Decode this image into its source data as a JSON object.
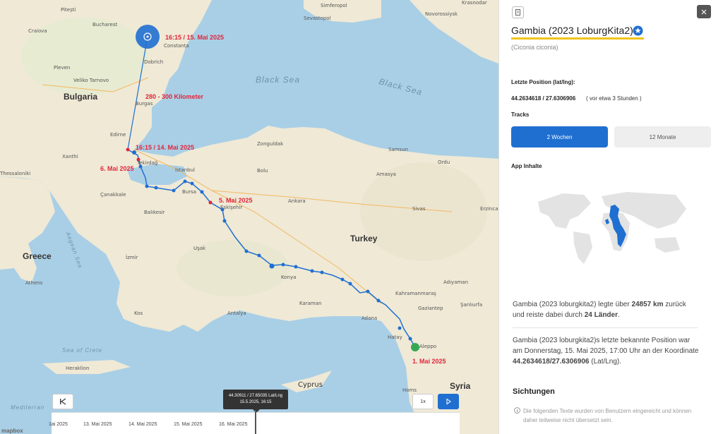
{
  "map": {
    "countries": {
      "bulgaria": "Bulgaria",
      "turkey": "Turkey",
      "greece": "Greece",
      "syria": "Syria"
    },
    "seas": {
      "black_sea_1": "Black Sea",
      "black_sea_2": "Black Sea",
      "aegean": "Aegean Sea",
      "crete": "Sea of Crete",
      "mediterranean": "Mediterran"
    },
    "cities": {
      "pitesti": "Pitești",
      "bucharest": "Bucharest",
      "craiova": "Craiova",
      "constanta": "Constanța",
      "pleven": "Pleven",
      "veliko": "Veliko Tarnovo",
      "burgas": "Burgas",
      "edirne": "Edirne",
      "xanthi": "Xanthi",
      "thessaloniki": "Thessaloniki",
      "tekirdag": "Tekirdağ",
      "istanbul": "İstanbul",
      "canakkale": "Çanakkale",
      "bursa": "Bursa",
      "eskisehir": "Eskişehir",
      "balikesir": "Balıkesir",
      "usak": "Uşak",
      "izmir": "İzmir",
      "athens": "Athens",
      "antalya": "Antalya",
      "konya": "Konya",
      "karaman": "Karaman",
      "ankara": "Ankara",
      "adana": "Adana",
      "hatay": "Hatay",
      "aleppo": "Aleppo",
      "kos": "Kos",
      "heraklion": "Heraklion",
      "cyprus": "Cyprus",
      "homs": "Homs",
      "sevastopol": "Sevastopol",
      "simferopol": "Simferopol",
      "novorossiysk": "Novorossiysk",
      "krasnodar": "Krasnodar",
      "zonguldak": "Zonguldak",
      "samsun": "Samsun",
      "ordu": "Ordu",
      "bolu": "Bolu",
      "amasya": "Amasya",
      "sivas": "Sivas",
      "erzincan": "Erzincan",
      "adiyaman": "Adıyaman",
      "gaziantep": "Gaziantep",
      "sanliurfa": "Şanlıurfa",
      "kahramanmaras": "Kahramanmaraş",
      "dobrich": "Dobrich"
    },
    "annotations": {
      "latest": "16:15 / 15. Mai 2025",
      "distance": "280 - 300 Kilometer",
      "may14": "16:15 / 14. Mai 2025",
      "may6": "6. Mai 2025",
      "may5": "5. Mai 2025",
      "may1": "1. Mai 2025"
    },
    "colors": {
      "track": "#1f6fd1",
      "annotation": "#e0263b",
      "water": "#a9cfe6",
      "land": "#efe9d6"
    }
  },
  "timeline": {
    "labels": [
      "1ai 2025",
      "13. Mai 2025",
      "14. Mai 2025",
      "15. Mai 2025",
      "16. Mai 2025"
    ],
    "tooltip_line1": "44.30911 / 27.65035 Lat/Lng",
    "tooltip_line2": "15.5.2025, 16:15",
    "prev_icon": "skip-back-icon",
    "speed_label": "1x",
    "play_icon": "play-icon",
    "mapbox": "mapbox"
  },
  "panel": {
    "close_icon": "close-icon",
    "doc_icon": "document-icon",
    "title": "Gambia (2023 LoburgKita2)",
    "species": "(Ciconia ciconia)",
    "last_position_label": "Letzte Position (lat/lng):",
    "last_position_value": "44.2634618 / 27.6306906",
    "last_position_ago": "( vor etwa 3 Stunden )",
    "tracks_label": "Tracks",
    "track_buttons": [
      "2 Wochen",
      "12 Monate"
    ],
    "app_content_label": "App Inhalte",
    "stat_text_1": "Gambia (2023 loburgkita2) legte über",
    "stat_km": "24857 km",
    "stat_text_2": "zurück und reiste dabei durch",
    "stat_countries": "24 Länder",
    "stat_text_3": ".",
    "last_known_text": "Gambia (2023 loburgkita2)s letzte bekannte Position war am Donnerstag, 15. Mai 2025, 17:00 Uhr an der Koordinate",
    "last_known_coord": "44.2634618/27.6306906",
    "last_known_unit": "(Lat/Lng).",
    "sightings_label": "Sichtungen",
    "notice": "Die folgenden Texte wurden von Benutzern eingereicht und können daher teilweise nicht übersetzt sein."
  }
}
